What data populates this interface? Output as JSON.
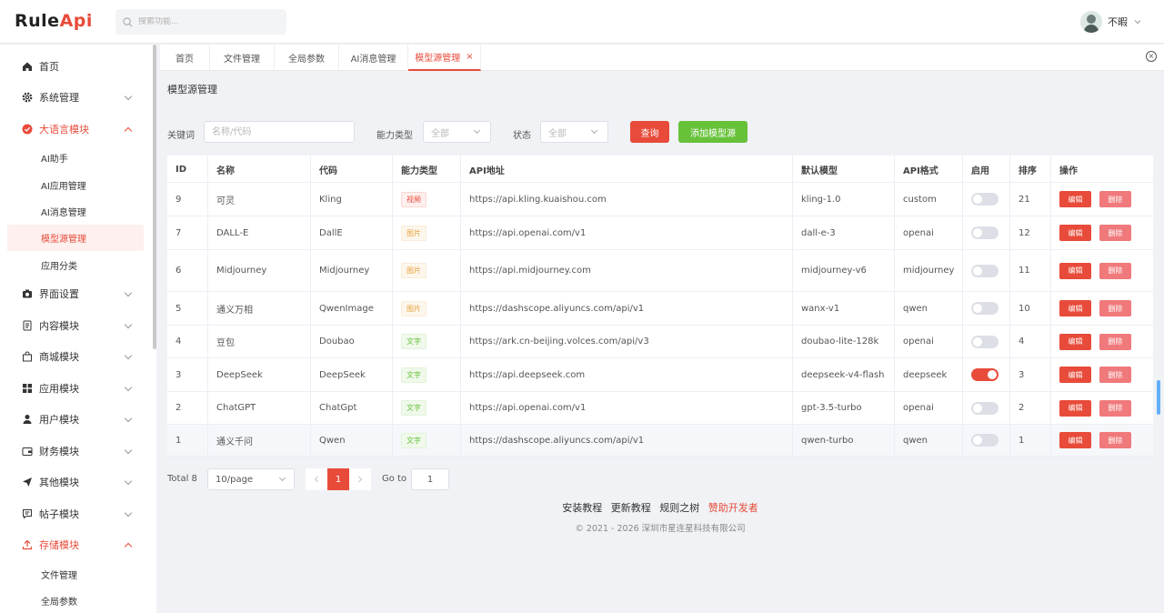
{
  "header": {
    "logo_main": "Rule",
    "logo_accent": "Api",
    "search_placeholder": "搜索功能...",
    "username": "不暇"
  },
  "sidebar": {
    "items": [
      {
        "label": "首页",
        "icon": "home-icon"
      },
      {
        "label": "系统管理",
        "icon": "gear-icon"
      },
      {
        "label": "大语言模块",
        "icon": "check-circle-icon"
      },
      {
        "label": "界面设置",
        "icon": "camera-icon"
      },
      {
        "label": "内容模块",
        "icon": "document-icon"
      },
      {
        "label": "商城模块",
        "icon": "shop-icon"
      },
      {
        "label": "应用模块",
        "icon": "grid-icon"
      },
      {
        "label": "用户模块",
        "icon": "user-icon"
      },
      {
        "label": "财务模块",
        "icon": "wallet-icon"
      },
      {
        "label": "其他模块",
        "icon": "send-icon"
      },
      {
        "label": "帖子模块",
        "icon": "chat-icon"
      },
      {
        "label": "存储模块",
        "icon": "upload-icon"
      }
    ],
    "llm_sub": [
      "AI助手",
      "AI应用管理",
      "AI消息管理",
      "模型源管理",
      "应用分类"
    ],
    "storage_sub": [
      "文件管理",
      "全局参数"
    ]
  },
  "tabs": [
    "首页",
    "文件管理",
    "全局参数",
    "AI消息管理",
    "模型源管理"
  ],
  "page": {
    "title": "模型源管理",
    "filters": {
      "keyword_label": "关键词",
      "keyword_placeholder": "名称/代码",
      "ability_label": "能力类型",
      "ability_value": "全部",
      "status_label": "状态",
      "status_value": "全部",
      "query_button": "查询",
      "add_button": "添加模型源"
    }
  },
  "table": {
    "columns": [
      "ID",
      "名称",
      "代码",
      "能力类型",
      "API地址",
      "默认模型",
      "API格式",
      "启用",
      "排序",
      "操作"
    ],
    "edit_label": "编辑",
    "delete_label": "删除",
    "rows": [
      {
        "id": "9",
        "name": "可灵",
        "code": "Kling",
        "type": "视频",
        "type_kind": "video",
        "api": "https://api.kling.kuaishou.com",
        "model": "kling-1.0",
        "format": "custom",
        "enabled": false,
        "sort": "21"
      },
      {
        "id": "7",
        "name": "DALL-E",
        "code": "DallE",
        "type": "图片",
        "type_kind": "image",
        "api": "https://api.openai.com/v1",
        "model": "dall-e-3",
        "format": "openai",
        "enabled": false,
        "sort": "12"
      },
      {
        "id": "6",
        "name": "Midjourney",
        "code": "Midjourney",
        "type": "图片",
        "type_kind": "image",
        "api": "https://api.midjourney.com",
        "model": "midjourney-v6",
        "format": "midjourney",
        "enabled": false,
        "sort": "11"
      },
      {
        "id": "5",
        "name": "通义万相",
        "code": "QwenImage",
        "type": "图片",
        "type_kind": "image",
        "api": "https://dashscope.aliyuncs.com/api/v1",
        "model": "wanx-v1",
        "format": "qwen",
        "enabled": false,
        "sort": "10"
      },
      {
        "id": "4",
        "name": "豆包",
        "code": "Doubao",
        "type": "文字",
        "type_kind": "text",
        "api": "https://ark.cn-beijing.volces.com/api/v3",
        "model": "doubao-lite-128k",
        "format": "openai",
        "enabled": false,
        "sort": "4"
      },
      {
        "id": "3",
        "name": "DeepSeek",
        "code": "DeepSeek",
        "type": "文字",
        "type_kind": "text",
        "api": "https://api.deepseek.com",
        "model": "deepseek-v4-flash",
        "format": "deepseek",
        "enabled": true,
        "sort": "3"
      },
      {
        "id": "2",
        "name": "ChatGPT",
        "code": "ChatGpt",
        "type": "文字",
        "type_kind": "text",
        "api": "https://api.openai.com/v1",
        "model": "gpt-3.5-turbo",
        "format": "openai",
        "enabled": false,
        "sort": "2"
      },
      {
        "id": "1",
        "name": "通义千问",
        "code": "Qwen",
        "type": "文字",
        "type_kind": "text",
        "api": "https://dashscope.aliyuncs.com/api/v1",
        "model": "qwen-turbo",
        "format": "qwen",
        "enabled": false,
        "sort": "1"
      }
    ]
  },
  "pagination": {
    "total": "Total 8",
    "page_size": "10/page",
    "current_page": "1",
    "goto_label": "Go to",
    "goto_value": "1"
  },
  "footer": {
    "links": [
      "安装教程",
      "更新教程",
      "规则之树"
    ],
    "sponsor": "赞助开发者",
    "copyright": "© 2021 - 2026 深圳市星连星科技有限公司"
  },
  "colors": {
    "accent": "#e84b3a",
    "success": "#67c23a",
    "warning": "#e6a23c"
  }
}
